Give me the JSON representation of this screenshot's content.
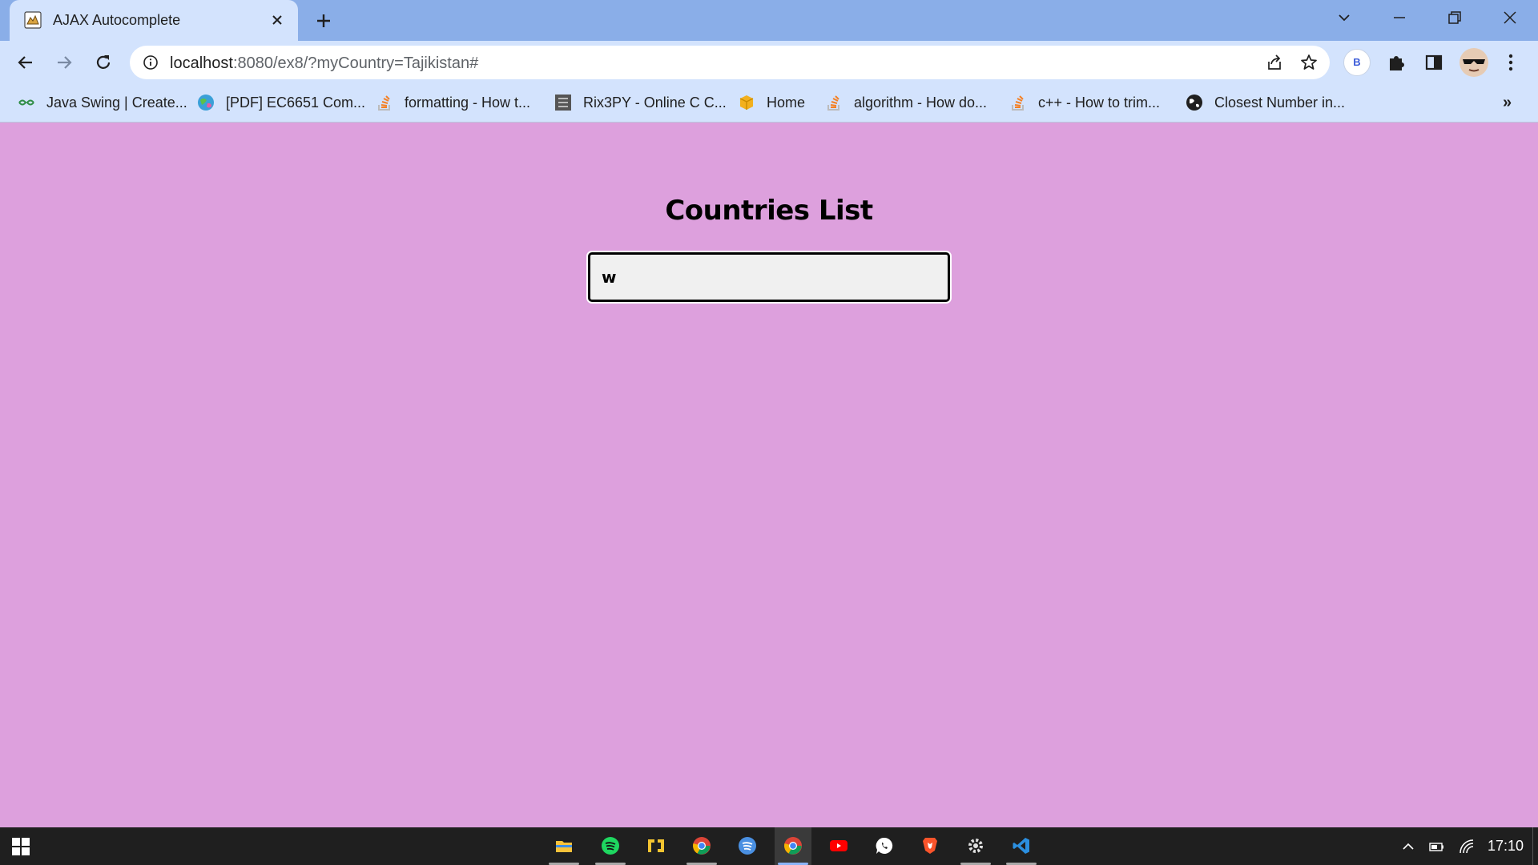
{
  "browser": {
    "tab": {
      "title": "AJAX Autocomplete",
      "favicon": "tomcat-icon"
    },
    "address_bar": {
      "url_host": "localhost",
      "url_rest": ":8080/ex8/?myCountry=Tajikistan#"
    },
    "profile_initial": "B",
    "bookmarks": [
      {
        "label": "Java Swing | Create...",
        "icon": "geeksforgeeks-icon"
      },
      {
        "label": "[PDF] EC6651 Com...",
        "icon": "globe-colorful-icon"
      },
      {
        "label": "formatting - How t...",
        "icon": "stackoverflow-icon"
      },
      {
        "label": "Rix3PY - Online C C...",
        "icon": "ideone-icon"
      },
      {
        "label": "Home",
        "icon": "box-icon"
      },
      {
        "label": "algorithm - How do...",
        "icon": "stackoverflow-icon"
      },
      {
        "label": "c++ - How to trim...",
        "icon": "stackoverflow-icon"
      },
      {
        "label": "Closest Number in...",
        "icon": "globe-icon"
      }
    ],
    "bookmarks_overflow": "»"
  },
  "page": {
    "title": "Countries List",
    "country_input_value": "w"
  },
  "taskbar": {
    "apps": [
      {
        "name": "file-explorer-icon"
      },
      {
        "name": "spotify-icon"
      },
      {
        "name": "app-yellow-icon"
      },
      {
        "name": "chrome-icon"
      },
      {
        "name": "spotify-blue-icon"
      },
      {
        "name": "chrome-icon",
        "active": true
      },
      {
        "name": "youtube-icon"
      },
      {
        "name": "whatsapp-icon"
      },
      {
        "name": "brave-icon"
      },
      {
        "name": "settings-icon"
      },
      {
        "name": "vscode-icon"
      }
    ],
    "clock": "17:10"
  },
  "colors": {
    "page_background": "#dda0dd",
    "titlebar": "#8aaee8",
    "toolbar": "#d3e3fd",
    "taskbar": "#1f1f1f"
  }
}
